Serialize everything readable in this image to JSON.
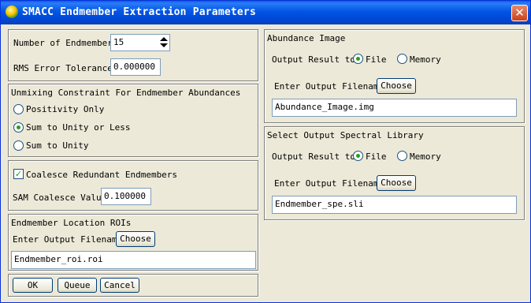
{
  "window": {
    "title": "SMACC Endmember Extraction Parameters"
  },
  "params": {
    "num_endmembers_label": "Number of Endmembers",
    "num_endmembers_value": "15",
    "rms_label": "RMS Error Tolerance",
    "rms_value": "0.000000"
  },
  "unmixing": {
    "title": "Unmixing Constraint For Endmember Abundances",
    "options": [
      "Positivity Only",
      "Sum to Unity or Less",
      "Sum to Unity"
    ],
    "selected": "Sum to Unity or Less"
  },
  "coalesce": {
    "checkbox_label": "Coalesce Redundant Endmembers",
    "checked": true,
    "sam_label": "SAM Coalesce Value",
    "sam_value": "0.100000"
  },
  "roi": {
    "title": "Endmember Location ROIs",
    "filename_label": "Enter Output Filename",
    "choose_label": "Choose",
    "filename_value": "Endmember_roi.roi"
  },
  "actions": {
    "ok": "OK",
    "queue": "Queue",
    "cancel": "Cancel"
  },
  "abundance": {
    "title": "Abundance Image",
    "output_label": "Output Result to",
    "file_label": "File",
    "memory_label": "Memory",
    "selected": "File",
    "filename_label": "Enter Output Filename",
    "choose_label": "Choose",
    "filename_value": "Abundance_Image.img"
  },
  "spectral": {
    "title": "Select Output Spectral Library",
    "output_label": "Output Result to",
    "file_label": "File",
    "memory_label": "Memory",
    "selected": "File",
    "filename_label": "Enter Output Filename",
    "choose_label": "Choose",
    "filename_value": "Endmember_spe.sli"
  }
}
